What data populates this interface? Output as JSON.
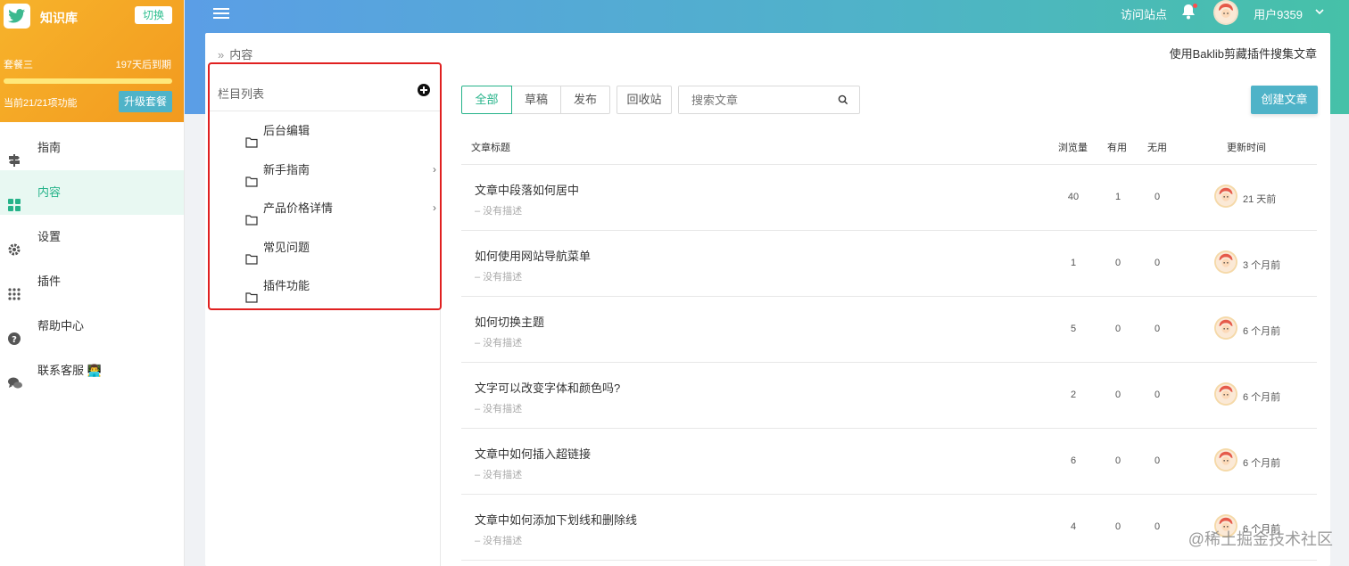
{
  "sidebar": {
    "brand_title": "知识库",
    "switch_label": "切换",
    "plan": "套餐三",
    "expire": "197天后到期",
    "usage_fraction": 1,
    "features": "当前21/21项功能",
    "upgrade_label": "升级套餐",
    "nav": [
      {
        "label": "指南",
        "icon": "signpost-icon"
      },
      {
        "label": "内容",
        "icon": "grid-icon"
      },
      {
        "label": "设置",
        "icon": "gear-icon"
      },
      {
        "label": "插件",
        "icon": "apps-grid-icon"
      },
      {
        "label": "帮助中心",
        "icon": "help-circle-icon"
      },
      {
        "label": "联系客服 👨‍💻",
        "icon": "chat-icon"
      }
    ]
  },
  "header": {
    "visit_site": "访问站点",
    "user_name": "用户9359"
  },
  "breadcrumb": {
    "current": "内容"
  },
  "clip_link": "使用Baklib剪藏插件搜集文章",
  "columns": {
    "title": "栏目列表",
    "items": [
      {
        "label": "后台编辑",
        "has_children": false
      },
      {
        "label": "新手指南",
        "has_children": true
      },
      {
        "label": "产品价格详情",
        "has_children": true
      },
      {
        "label": "常见问题",
        "has_children": false
      },
      {
        "label": "插件功能",
        "has_children": false
      }
    ]
  },
  "filters": {
    "tabs": [
      "全部",
      "草稿",
      "发布"
    ],
    "recycle": "回收站",
    "search_placeholder": "搜索文章",
    "create_label": "创建文章"
  },
  "table": {
    "headers": {
      "title": "文章标题",
      "views": "浏览量",
      "useful": "有用",
      "useless": "无用",
      "updated": "更新时间"
    },
    "rows": [
      {
        "title": "文章中段落如何居中",
        "desc": "– 没有描述",
        "views": "40",
        "useful": "1",
        "useless": "0",
        "updated": "21 天前"
      },
      {
        "title": "如何使用网站导航菜单",
        "desc": "– 没有描述",
        "views": "1",
        "useful": "0",
        "useless": "0",
        "updated": "3 个月前"
      },
      {
        "title": "如何切换主题",
        "desc": "– 没有描述",
        "views": "5",
        "useful": "0",
        "useless": "0",
        "updated": "6 个月前"
      },
      {
        "title": "文字可以改变字体和颜色吗?",
        "desc": "– 没有描述",
        "views": "2",
        "useful": "0",
        "useless": "0",
        "updated": "6 个月前"
      },
      {
        "title": "文章中如何插入超链接",
        "desc": "– 没有描述",
        "views": "6",
        "useful": "0",
        "useless": "0",
        "updated": "6 个月前"
      },
      {
        "title": "文章中如何添加下划线和删除线",
        "desc": "– 没有描述",
        "views": "4",
        "useful": "0",
        "useless": "0",
        "updated": "6 个月前"
      }
    ]
  },
  "watermark": "@稀土掘金技术社区",
  "colors": {
    "accent": "#26b38a",
    "brand_orange": "#f29a1f",
    "highlight_border": "#e02020"
  }
}
